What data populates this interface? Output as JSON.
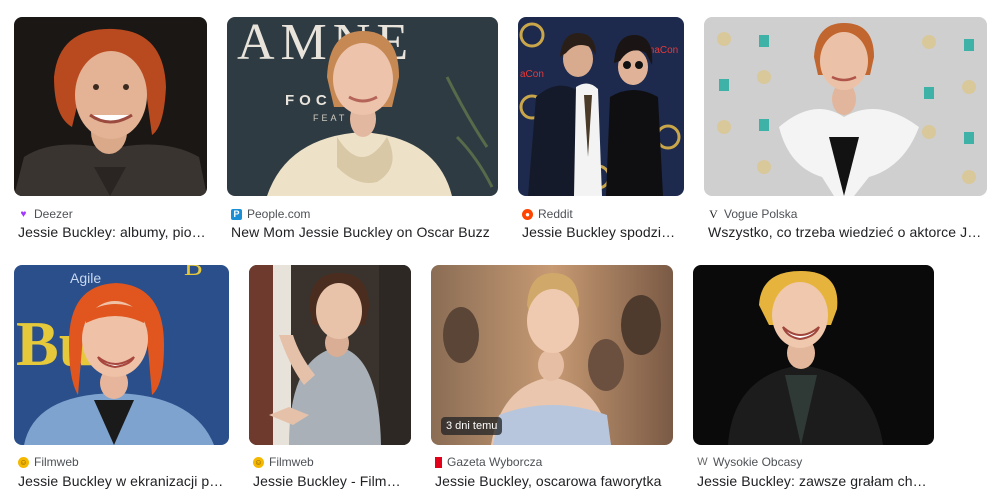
{
  "results": [
    {
      "source": "Deezer",
      "title": "Jessie Buckley: albumy, piosenki, playlisty",
      "favicon": "heart-icon",
      "favicon_color": "#a238ff"
    },
    {
      "source": "People.com",
      "title": "New Mom Jessie Buckley on Oscar Buzz",
      "favicon": "people-logo-icon",
      "favicon_color": "#1a8fd6"
    },
    {
      "source": "Reddit",
      "title": "Jessie Buckley spodziewa się dziecka",
      "favicon": "reddit-icon",
      "favicon_color": "#ff4500"
    },
    {
      "source": "Vogue Polska",
      "title": "Wszystko, co trzeba wiedzieć o aktorce Jessie Buckley",
      "favicon": "vogue-icon",
      "favicon_color": "#222222"
    },
    {
      "source": "Filmweb",
      "title": "Jessie Buckley w ekranizacji powieści",
      "favicon": "filmweb-icon",
      "favicon_color": "#f5b800"
    },
    {
      "source": "Filmweb",
      "title": "Jessie Buckley - Filmweb",
      "favicon": "filmweb-icon",
      "favicon_color": "#f5b800"
    },
    {
      "source": "Gazeta Wyborcza",
      "title": "Jessie Buckley, oscarowa faworytka",
      "favicon": "wyborcza-icon",
      "favicon_color": "#e2001a",
      "badge": "3 dni temu"
    },
    {
      "source": "Wysokie Obcasy",
      "title": "Jessie Buckley: zawsze grałam charaktery",
      "favicon": "wysokie-obcasy-icon",
      "favicon_color": "#666666"
    }
  ],
  "colors": {
    "source_text": "#4d5156",
    "title_text": "#202124"
  }
}
